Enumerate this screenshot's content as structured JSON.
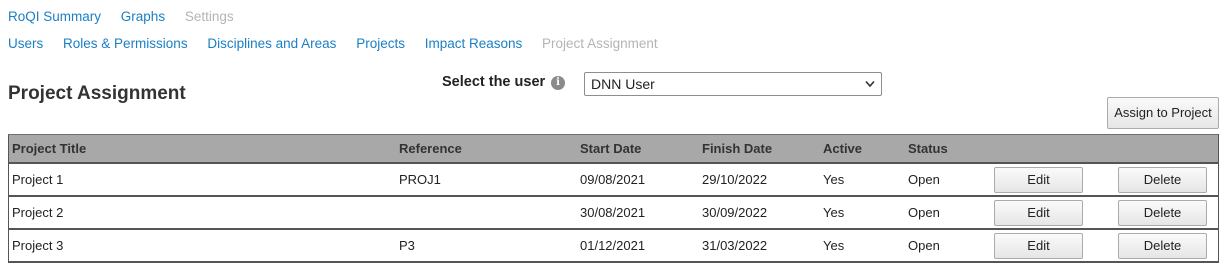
{
  "nav_primary": [
    {
      "label": "RoQI Summary",
      "disabled": false
    },
    {
      "label": "Graphs",
      "disabled": false
    },
    {
      "label": "Settings",
      "disabled": true
    }
  ],
  "nav_secondary": [
    {
      "label": "Users",
      "disabled": false
    },
    {
      "label": "Roles & Permissions",
      "disabled": false
    },
    {
      "label": "Disciplines and Areas",
      "disabled": false
    },
    {
      "label": "Projects",
      "disabled": false
    },
    {
      "label": "Impact Reasons",
      "disabled": false
    },
    {
      "label": "Project Assignment",
      "disabled": true
    }
  ],
  "page_title": "Project Assignment",
  "user_select": {
    "label": "Select the user",
    "info_icon": "info-icon",
    "value": "DNN User"
  },
  "assign_button_label": "Assign to Project",
  "table": {
    "columns": [
      "Project Title",
      "Reference",
      "Start Date",
      "Finish Date",
      "Active",
      "Status",
      "",
      ""
    ],
    "edit_label": "Edit",
    "delete_label": "Delete",
    "rows": [
      {
        "title": "Project 1",
        "reference": "PROJ1",
        "start": "09/08/2021",
        "finish": "29/10/2022",
        "active": "Yes",
        "status": "Open"
      },
      {
        "title": "Project 2",
        "reference": "",
        "start": "30/08/2021",
        "finish": "30/09/2022",
        "active": "Yes",
        "status": "Open"
      },
      {
        "title": "Project 3",
        "reference": "P3",
        "start": "01/12/2021",
        "finish": "31/03/2022",
        "active": "Yes",
        "status": "Open"
      }
    ]
  },
  "colors": {
    "link": "#1b7fc4",
    "link_disabled": "#b4b4b4",
    "table_header_bg": "#a8a8a8"
  }
}
